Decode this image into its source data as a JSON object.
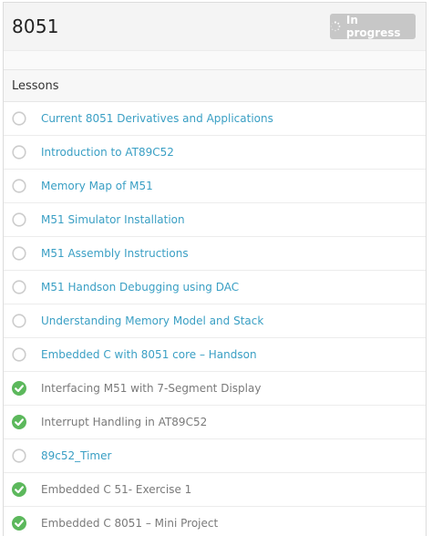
{
  "course": {
    "title": "8051",
    "status_label": "In progress"
  },
  "section": {
    "title": "Lessons"
  },
  "lessons": [
    {
      "label": "Current 8051 Derivatives and Applications",
      "completed": false
    },
    {
      "label": "Introduction to AT89C52",
      "completed": false
    },
    {
      "label": "Memory Map of M51",
      "completed": false
    },
    {
      "label": "M51 Simulator Installation",
      "completed": false
    },
    {
      "label": "M51 Assembly Instructions",
      "completed": false
    },
    {
      "label": "M51 Handson Debugging using DAC",
      "completed": false
    },
    {
      "label": "Understanding Memory Model and Stack",
      "completed": false
    },
    {
      "label": "Embedded C with 8051 core – Handson",
      "completed": false
    },
    {
      "label": "Interfacing M51 with 7-Segment Display",
      "completed": true
    },
    {
      "label": "Interrupt Handling in AT89C52",
      "completed": true
    },
    {
      "label": "89c52_Timer",
      "completed": false
    },
    {
      "label": "Embedded C 51- Exercise 1",
      "completed": true
    },
    {
      "label": "Embedded C 8051 – Mini Project",
      "completed": true
    }
  ],
  "colors": {
    "link": "#3a9fc4",
    "completed_text": "#7a7a7a",
    "check": "#5cb85c",
    "pending_circle": "#cccccc",
    "status_button": "#c7c7c7"
  },
  "icons": {
    "status": "spinner-icon",
    "pending": "empty-circle-icon",
    "completed": "check-circle-icon"
  }
}
